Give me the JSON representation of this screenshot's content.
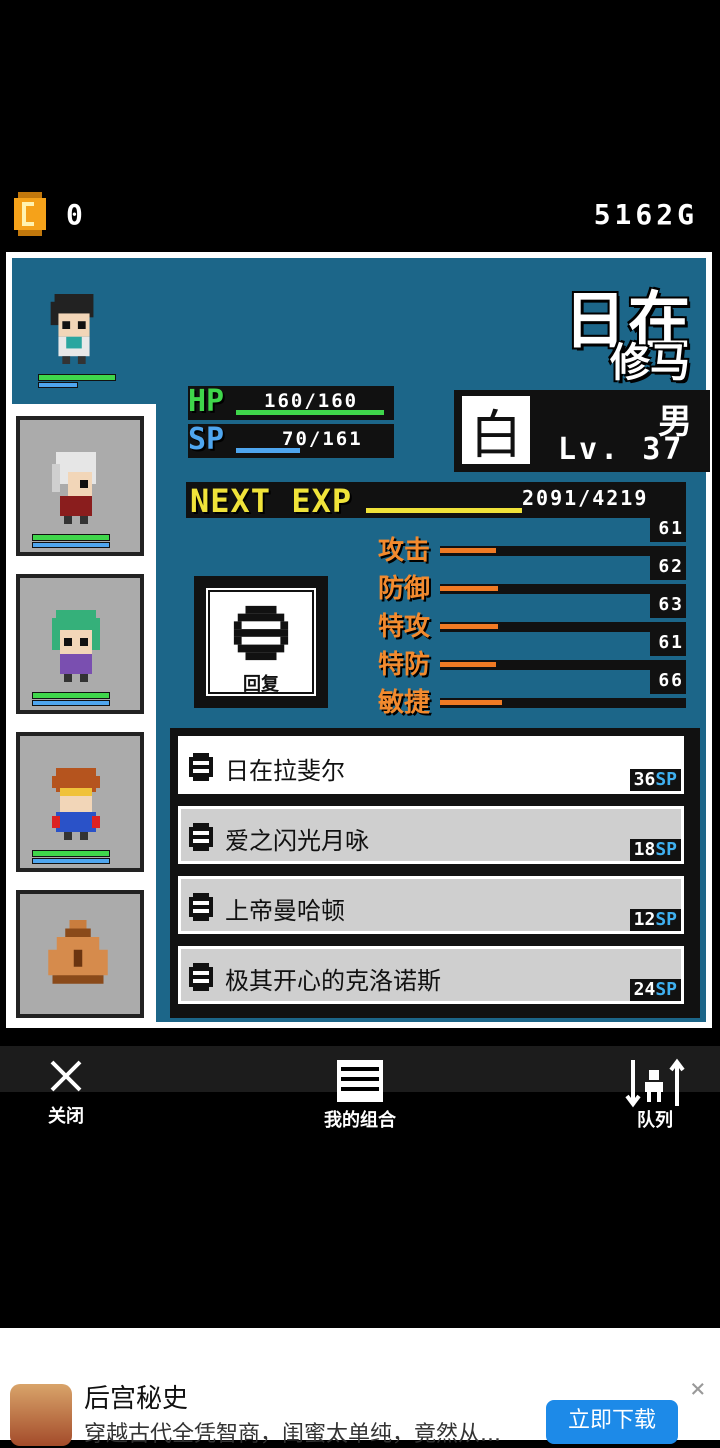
{
  "top": {
    "coin_count": "0",
    "gold": "5162G"
  },
  "character": {
    "name_line1": "日在",
    "name_line2": "修马",
    "hp_label": "HP",
    "hp_value": "160/160",
    "hp_fraction": 1.0,
    "sp_label": "SP",
    "sp_value": "70/161",
    "sp_fraction": 0.43,
    "class_char": "白",
    "gender": "男",
    "level": "Lv. 37",
    "next_exp_label": "NEXT EXP",
    "next_exp_value": "2091/4219",
    "exp_fraction": 0.5
  },
  "attributes": [
    {
      "label": "攻击",
      "value": "61"
    },
    {
      "label": "防御",
      "value": "62"
    },
    {
      "label": "特攻",
      "value": "63"
    },
    {
      "label": "特防",
      "value": "61"
    },
    {
      "label": "敏捷",
      "value": "66"
    }
  ],
  "recover_label": "回复",
  "skills": [
    {
      "name": "日在拉斐尔",
      "cost": "36",
      "unit": "SP"
    },
    {
      "name": "爱之闪光月咏",
      "cost": "18",
      "unit": "SP"
    },
    {
      "name": "上帝曼哈顿",
      "cost": "12",
      "unit": "SP"
    },
    {
      "name": "极其开心的克洛诺斯",
      "cost": "24",
      "unit": "SP"
    }
  ],
  "nav": {
    "close": "关闭",
    "combo": "我的组合",
    "team": "队列"
  },
  "ad": {
    "title": "后宫秘史",
    "desc": "穿越古代全凭智商，闺蜜太单纯，竟然从...",
    "button": "立即下载"
  },
  "colors": {
    "panel": "#1c6689",
    "hp": "#3fd64b",
    "sp": "#4fa6ef",
    "exp": "#f0e33a",
    "attr": "#f28a2e"
  }
}
